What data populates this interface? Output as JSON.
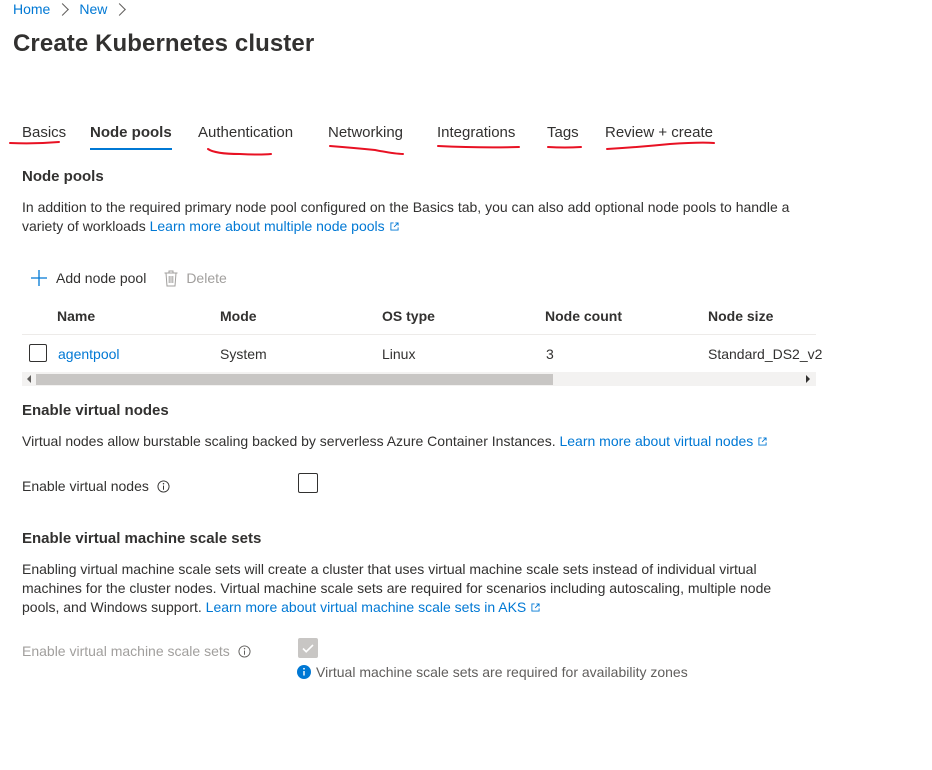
{
  "breadcrumb": {
    "items": [
      "Home",
      "New"
    ]
  },
  "page": {
    "title": "Create Kubernetes cluster"
  },
  "tabs": [
    {
      "label": "Basics"
    },
    {
      "label": "Node pools",
      "active": true
    },
    {
      "label": "Authentication"
    },
    {
      "label": "Networking"
    },
    {
      "label": "Integrations"
    },
    {
      "label": "Tags"
    },
    {
      "label": "Review + create"
    }
  ],
  "node_pools": {
    "title": "Node pools",
    "description": "In addition to the required primary node pool configured on the Basics tab, you can also add optional node pools to handle a variety of workloads",
    "learn_more": "Learn more about multiple node pools",
    "add_label": "Add node pool",
    "delete_label": "Delete",
    "columns": [
      "Name",
      "Mode",
      "OS type",
      "Node count",
      "Node size"
    ],
    "rows": [
      {
        "name": "agentpool",
        "mode": "System",
        "os_type": "Linux",
        "node_count": "3",
        "node_size": "Standard_DS2_v2"
      }
    ]
  },
  "virtual_nodes": {
    "title": "Enable virtual nodes",
    "description": "Virtual nodes allow burstable scaling backed by serverless Azure Container Instances.",
    "learn_more": "Learn more about virtual nodes",
    "field_label": "Enable virtual nodes",
    "checked": false
  },
  "vmss": {
    "title": "Enable virtual machine scale sets",
    "description": "Enabling virtual machine scale sets will create a cluster that uses virtual machine scale sets instead of individual virtual machines for the cluster nodes. Virtual machine scale sets are required for scenarios including autoscaling, multiple node pools, and Windows support.",
    "learn_more": "Learn more about virtual machine scale sets in AKS",
    "field_label": "Enable virtual machine scale sets",
    "checked": true,
    "hint": "Virtual machine scale sets are required for availability zones"
  },
  "colors": {
    "accent": "#0078d4",
    "annotation": "#e81123",
    "disabled": "#a19f9d"
  },
  "icons": {
    "add": "plus-icon",
    "delete": "trash-icon",
    "external": "external-link-icon",
    "info": "info-icon",
    "info_filled": "info-filled-icon"
  }
}
